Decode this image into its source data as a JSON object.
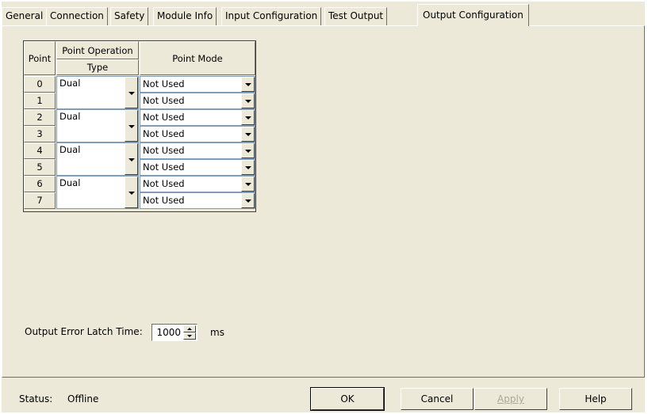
{
  "tabs": [
    {
      "label": "General"
    },
    {
      "label": "Connection"
    },
    {
      "label": "Safety"
    },
    {
      "label": "Module Info"
    },
    {
      "label": "Input Configuration"
    },
    {
      "label": "Test Output"
    },
    {
      "label": "Output Configuration",
      "active": true
    }
  ],
  "grid": {
    "headers": {
      "point": "Point",
      "point_operation": "Point Operation",
      "type": "Type",
      "point_mode": "Point Mode"
    },
    "pairs": [
      {
        "points": [
          "0",
          "1"
        ],
        "type": "Dual",
        "modes": [
          "Not Used",
          "Not Used"
        ]
      },
      {
        "points": [
          "2",
          "3"
        ],
        "type": "Dual",
        "modes": [
          "Not Used",
          "Not Used"
        ]
      },
      {
        "points": [
          "4",
          "5"
        ],
        "type": "Dual",
        "modes": [
          "Not Used",
          "Not Used"
        ]
      },
      {
        "points": [
          "6",
          "7"
        ],
        "type": "Dual",
        "modes": [
          "Not Used",
          "Not Used"
        ]
      }
    ]
  },
  "latch": {
    "label": "Output Error Latch Time:",
    "value": "1000",
    "unit": "ms"
  },
  "footer": {
    "status_label": "Status:",
    "status_value": "Offline",
    "ok": "OK",
    "cancel": "Cancel",
    "apply": "Apply",
    "help": "Help"
  }
}
